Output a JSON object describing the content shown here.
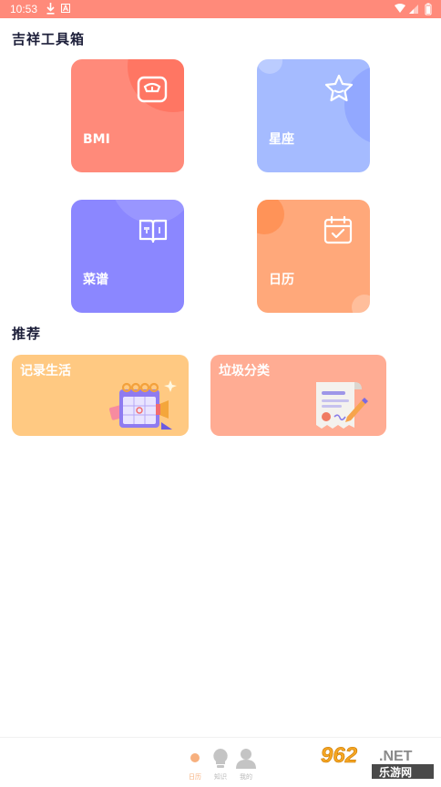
{
  "status_bar": {
    "time": "10:53"
  },
  "tools_section": {
    "title": "吉祥工具箱",
    "items": [
      {
        "label": "BMI",
        "color": "#ff8a7a",
        "icon": "scale-icon"
      },
      {
        "label": "星座",
        "color": "#a5bbff",
        "icon": "star-icon"
      },
      {
        "label": "菜谱",
        "color": "#8b87ff",
        "icon": "recipe-book-icon"
      },
      {
        "label": "日历",
        "color": "#ffa87a",
        "icon": "calendar-icon"
      }
    ]
  },
  "recommend_section": {
    "title": "推荐",
    "items": [
      {
        "label": "记录生活",
        "color": "#ffc982",
        "illustration": "calendar-illustration"
      },
      {
        "label": "垃圾分类",
        "color": "#ffac93",
        "illustration": "document-illustration"
      }
    ]
  },
  "bottom_nav": {
    "items": [
      {
        "label": "日历",
        "icon": "home-dot-icon",
        "active": true
      },
      {
        "label": "知识",
        "icon": "bulb-icon",
        "active": false
      },
      {
        "label": "我的",
        "icon": "user-icon",
        "active": false
      }
    ]
  },
  "watermark": {
    "number": "962",
    "suffix": ".NET",
    "text": "乐游网"
  }
}
